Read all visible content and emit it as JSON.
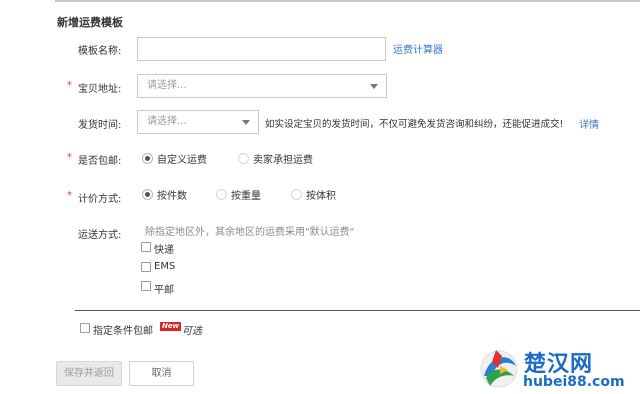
{
  "page": {
    "title": "新增运费模板"
  },
  "form": {
    "template_name": {
      "label": "模板名称:",
      "value": "",
      "link": "运费计算器"
    },
    "location": {
      "required_mark": "*",
      "label": "宝贝地址:",
      "placeholder": "请选择..."
    },
    "ship_time": {
      "label": "发货时间:",
      "placeholder": "请选择...",
      "hint": "如实设定宝贝的发货时间，不仅可避免发货咨询和纠纷，还能促进成交!",
      "link": "详情"
    },
    "free_shipping": {
      "required_mark": "*",
      "label": "是否包邮:",
      "options": [
        {
          "label": "自定义运费",
          "selected": true
        },
        {
          "label": "卖家承担运费",
          "selected": false
        }
      ]
    },
    "pricing": {
      "required_mark": "*",
      "label": "计价方式:",
      "options": [
        {
          "label": "按件数",
          "selected": true
        },
        {
          "label": "按重量",
          "selected": false
        },
        {
          "label": "按体积",
          "selected": false
        }
      ]
    },
    "delivery": {
      "label": "运送方式:",
      "hint": "除指定地区外，其余地区的运费采用\"默认运费\"",
      "options": [
        {
          "label": "快递",
          "checked": false
        },
        {
          "label": "EMS",
          "checked": false
        },
        {
          "label": "平邮",
          "checked": false
        }
      ]
    },
    "conditional_free": {
      "label": "指定条件包邮",
      "badge": "New",
      "suffix": "可选",
      "checked": false
    }
  },
  "actions": {
    "save_label": "保存并返回",
    "cancel_label": "取消"
  },
  "watermark": {
    "brand_text": "楚汉网",
    "url_text": "hubei88.com"
  },
  "colors": {
    "link": "#3a78c3",
    "required": "#e4393c",
    "badge": "#d9262a"
  }
}
